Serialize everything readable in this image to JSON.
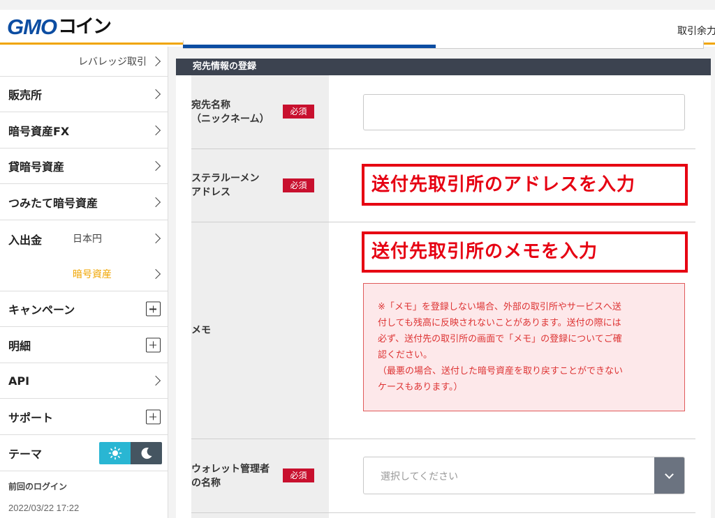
{
  "header": {
    "logo_gmo": "GMO",
    "logo_coin": "コイン",
    "right_text": "取引余力"
  },
  "sidebar": {
    "leverage": "レバレッジ取引",
    "items": [
      {
        "label": "販売所"
      },
      {
        "label": "暗号資産FX"
      },
      {
        "label": "貸暗号資産"
      },
      {
        "label": "つみたて暗号資産"
      }
    ],
    "deposit": {
      "label": "入出金",
      "yen": "日本円",
      "crypto": "暗号資産"
    },
    "campaign": "キャンペーン",
    "details": "明細",
    "api": "API",
    "support": "サポート",
    "theme": "テーマ",
    "last_login_label": "前回のログイン",
    "last_login_date": "2022/03/22 17:22"
  },
  "section_title": "宛先情報の登録",
  "form": {
    "required": "必須",
    "nickname_label_1": "宛先名称",
    "nickname_label_2": "（ニックネーム）",
    "address_label_1": "ステラルーメン",
    "address_label_2": "アドレス",
    "address_annotation": "送付先取引所のアドレスを入力",
    "memo_label": "メモ",
    "memo_annotation": "送付先取引所のメモを入力",
    "memo_warning_1": "※「メモ」を登録しない場合、外部の取引所やサービスへ送",
    "memo_warning_2": "付しても残高に反映されないことがあります。送付の際には",
    "memo_warning_3": "必ず、送付先の取引所の画面で「メモ」の登録についてご確",
    "memo_warning_4": "認ください。",
    "memo_warning_5": "（最悪の場合、送付した暗号資産を取り戻すことができない",
    "memo_warning_6": "ケースもあります。）",
    "wallet_label_1": "ウォレット管理者",
    "wallet_label_2": "の名称",
    "wallet_placeholder": "選択してください"
  },
  "colors": {
    "brand_blue": "#0c4da2",
    "accent_orange": "#f0a500",
    "required_red": "#c8102e",
    "annotation_red": "#e60012"
  }
}
